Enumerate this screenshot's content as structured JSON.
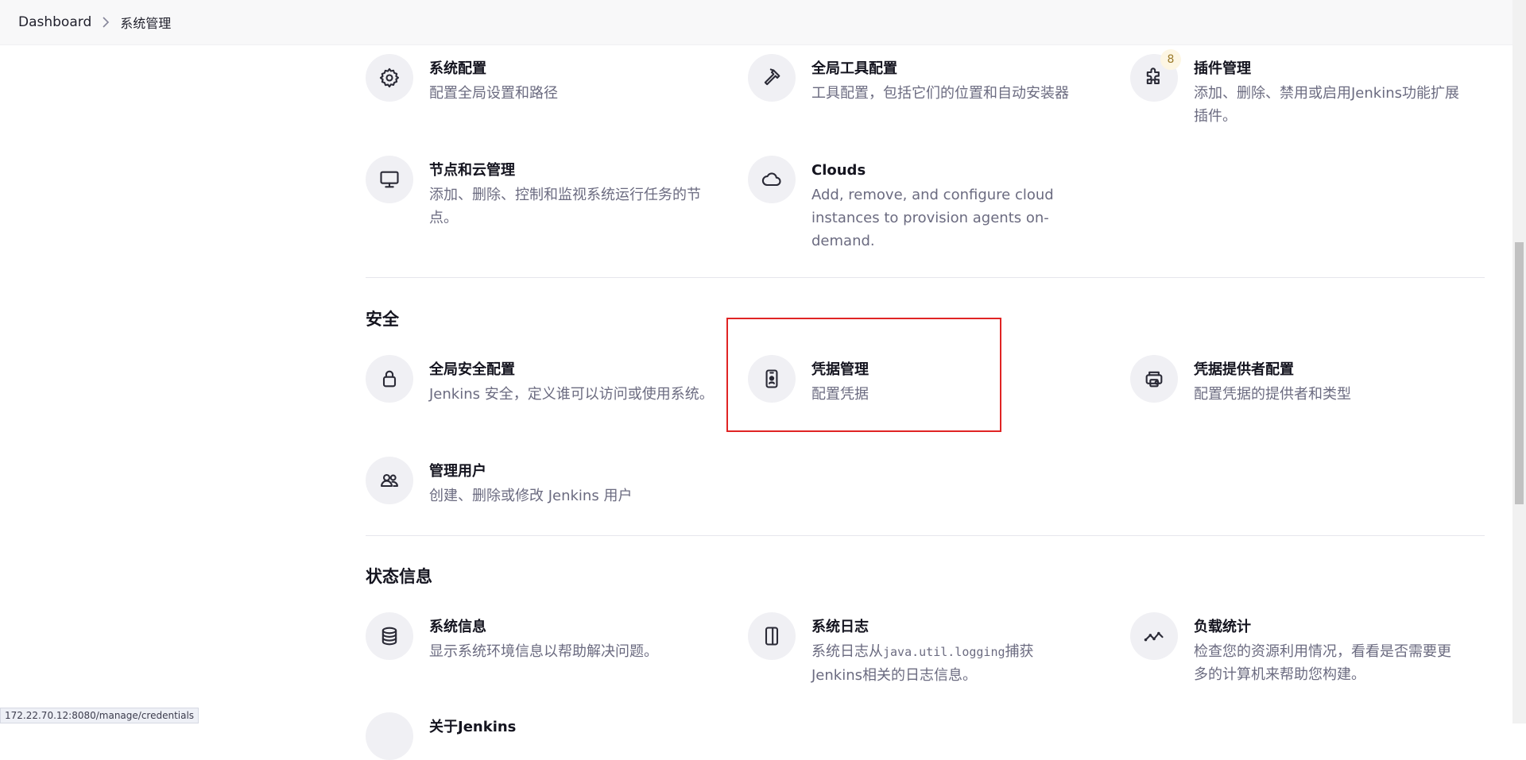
{
  "breadcrumb": {
    "home": "Dashboard",
    "current": "系统管理"
  },
  "sections": {
    "security_title": "安全",
    "status_title": "状态信息"
  },
  "items": {
    "system_config": {
      "title": "系统配置",
      "desc": "配置全局设置和路径"
    },
    "global_tools": {
      "title": "全局工具配置",
      "desc": "工具配置，包括它们的位置和自动安装器"
    },
    "plugins": {
      "title": "插件管理",
      "desc": "添加、删除、禁用或启用Jenkins功能扩展插件。",
      "badge": "8"
    },
    "nodes": {
      "title": "节点和云管理",
      "desc": "添加、删除、控制和监视系统运行任务的节点。"
    },
    "clouds": {
      "title": "Clouds",
      "desc": "Add, remove, and configure cloud instances to provision agents on-demand."
    },
    "global_security": {
      "title": "全局安全配置",
      "desc": "Jenkins 安全，定义谁可以访问或使用系统。"
    },
    "credentials": {
      "title": "凭据管理",
      "desc": "配置凭据"
    },
    "credential_providers": {
      "title": "凭据提供者配置",
      "desc": "配置凭据的提供者和类型"
    },
    "manage_users": {
      "title": "管理用户",
      "desc": "创建、删除或修改 Jenkins 用户"
    },
    "system_info": {
      "title": "系统信息",
      "desc": "显示系统环境信息以帮助解决问题。"
    },
    "system_log": {
      "title": "系统日志",
      "desc_prefix": "系统日志从",
      "desc_code": "java.util.logging",
      "desc_suffix": "捕获Jenkins相关的日志信息。"
    },
    "load_stats": {
      "title": "负载统计",
      "desc": "检查您的资源利用情况，看看是否需要更多的计算机来帮助您构建。"
    },
    "about_jenkins": {
      "title": "关于Jenkins"
    }
  },
  "status_bar": {
    "url": "172.22.70.12:8080/manage/credentials"
  },
  "colors": {
    "highlight_border": "#e02424",
    "icon_bg": "#f0f0f4",
    "desc_text": "#6b6b80",
    "badge_bg": "#fdf6e3"
  },
  "icons": {
    "system_config": "gear-icon",
    "global_tools": "hammer-icon",
    "plugins": "puzzle-icon",
    "nodes": "monitor-icon",
    "clouds": "cloud-icon",
    "global_security": "lock-icon",
    "credentials": "id-card-icon",
    "credential_providers": "key-provider-icon",
    "manage_users": "users-icon",
    "system_info": "database-icon",
    "system_log": "log-panel-icon",
    "load_stats": "trend-line-icon"
  }
}
